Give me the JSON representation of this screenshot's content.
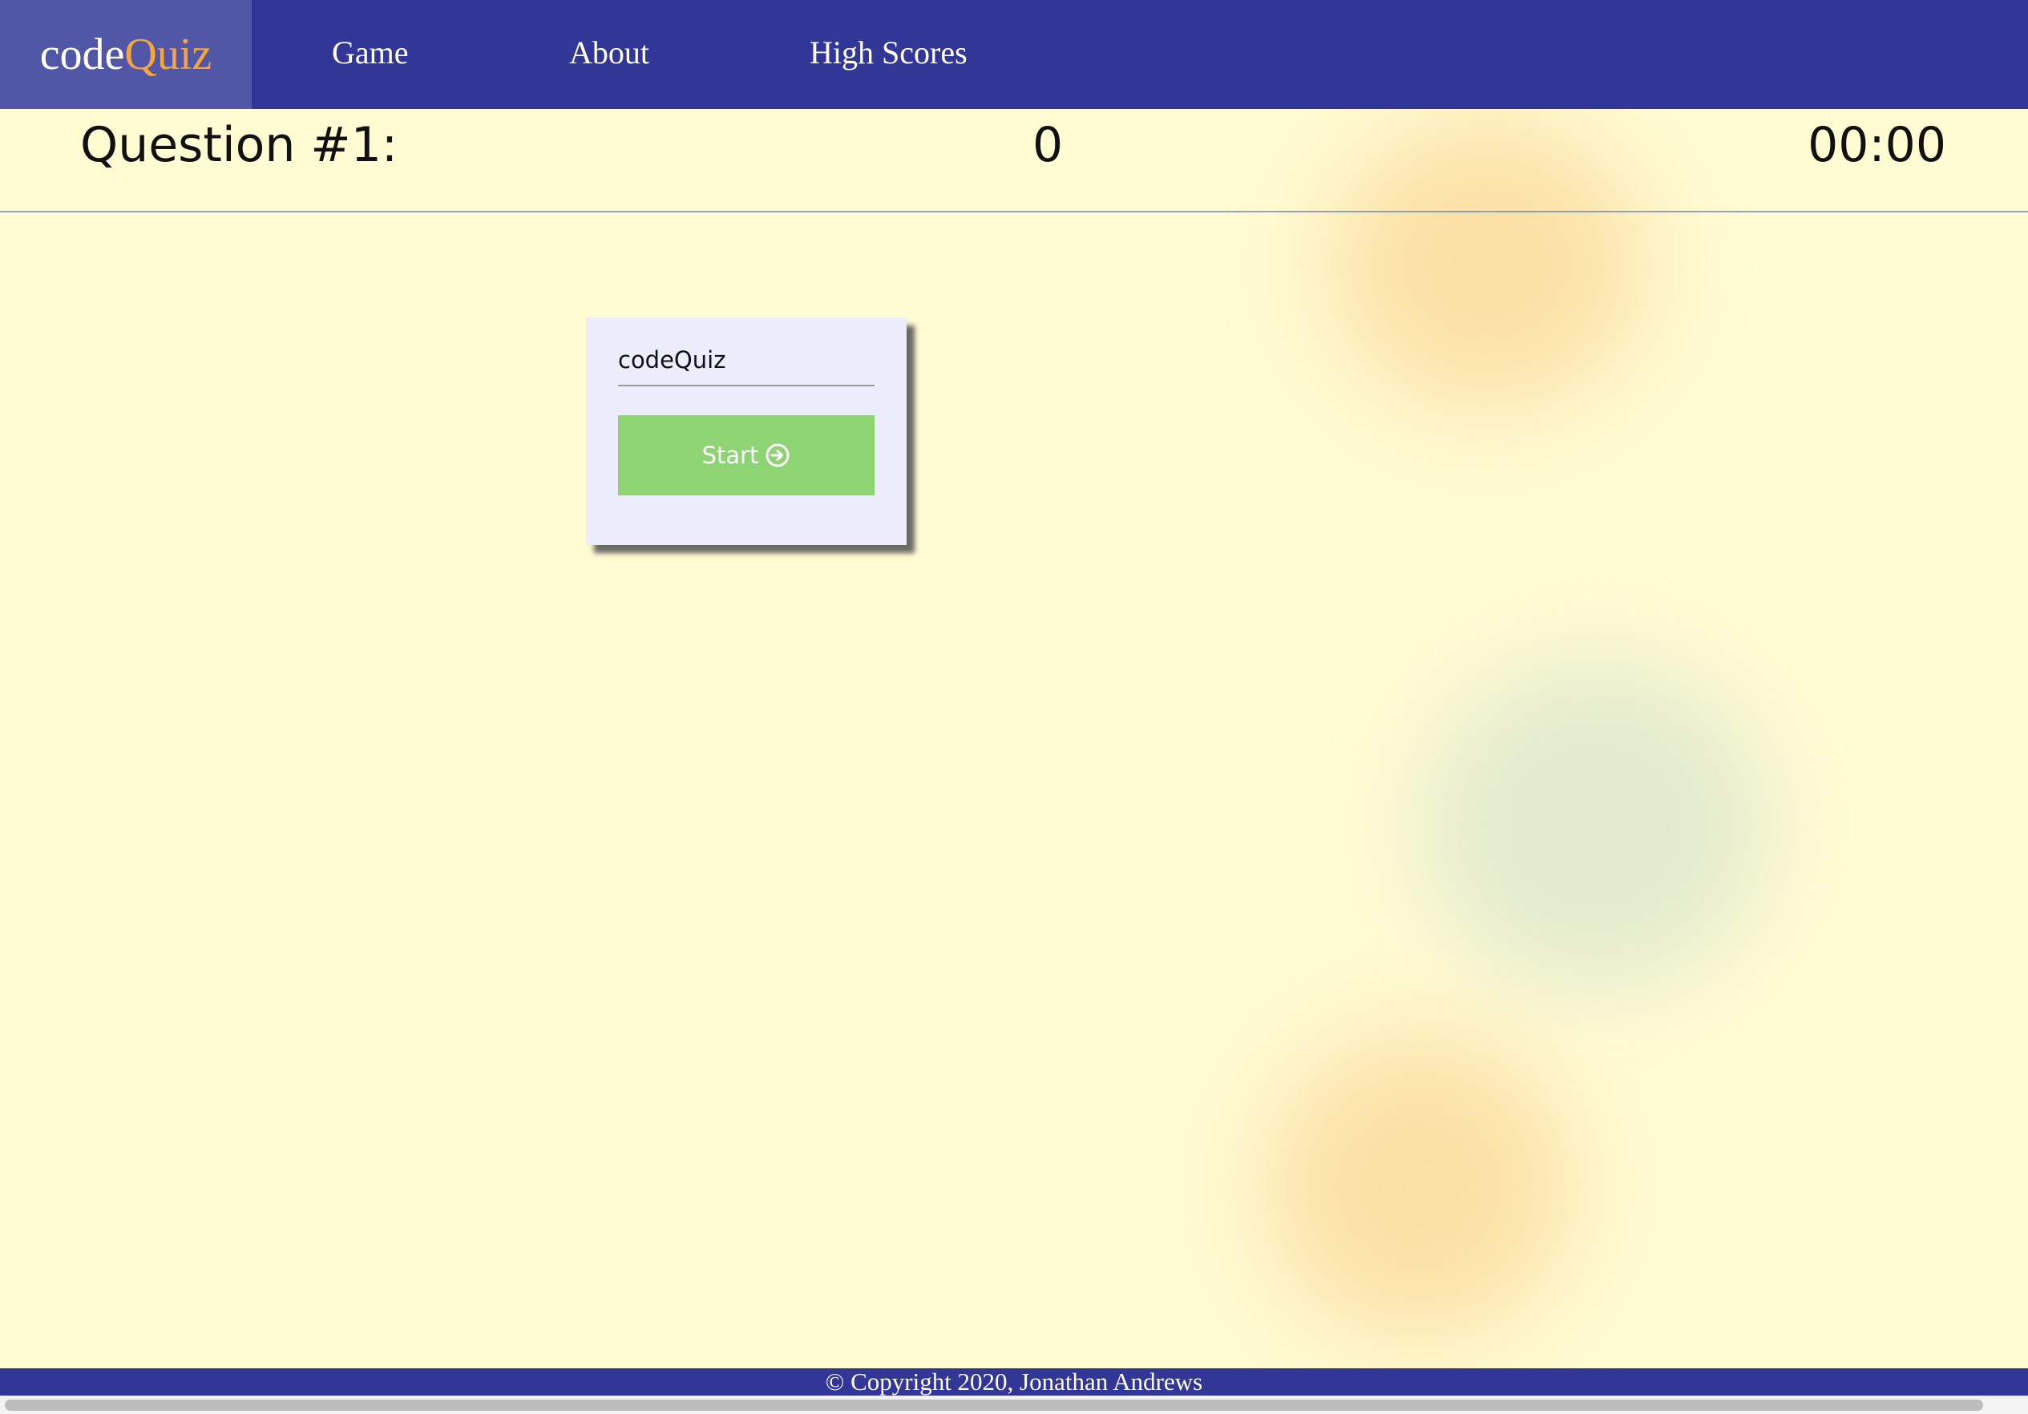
{
  "brand": {
    "prefix": "code",
    "accent": "Quiz"
  },
  "nav": {
    "items": [
      {
        "label": "Game"
      },
      {
        "label": "About"
      },
      {
        "label": "High Scores"
      }
    ]
  },
  "status": {
    "question_label": "Question #1:",
    "score": "0",
    "timer": "00:00"
  },
  "card": {
    "title": "codeQuiz",
    "start_label": "Start",
    "start_icon": "arrow-circle-right-icon"
  },
  "footer": {
    "text": "© Copyright 2020, Jonathan Andrews"
  },
  "colors": {
    "nav_bg": "#323797",
    "brand_bg": "#5256a6",
    "brand_accent": "#f6a43e",
    "page_bg": "#fffbd3",
    "card_bg": "#ececfc",
    "button_bg": "#8fd474"
  }
}
